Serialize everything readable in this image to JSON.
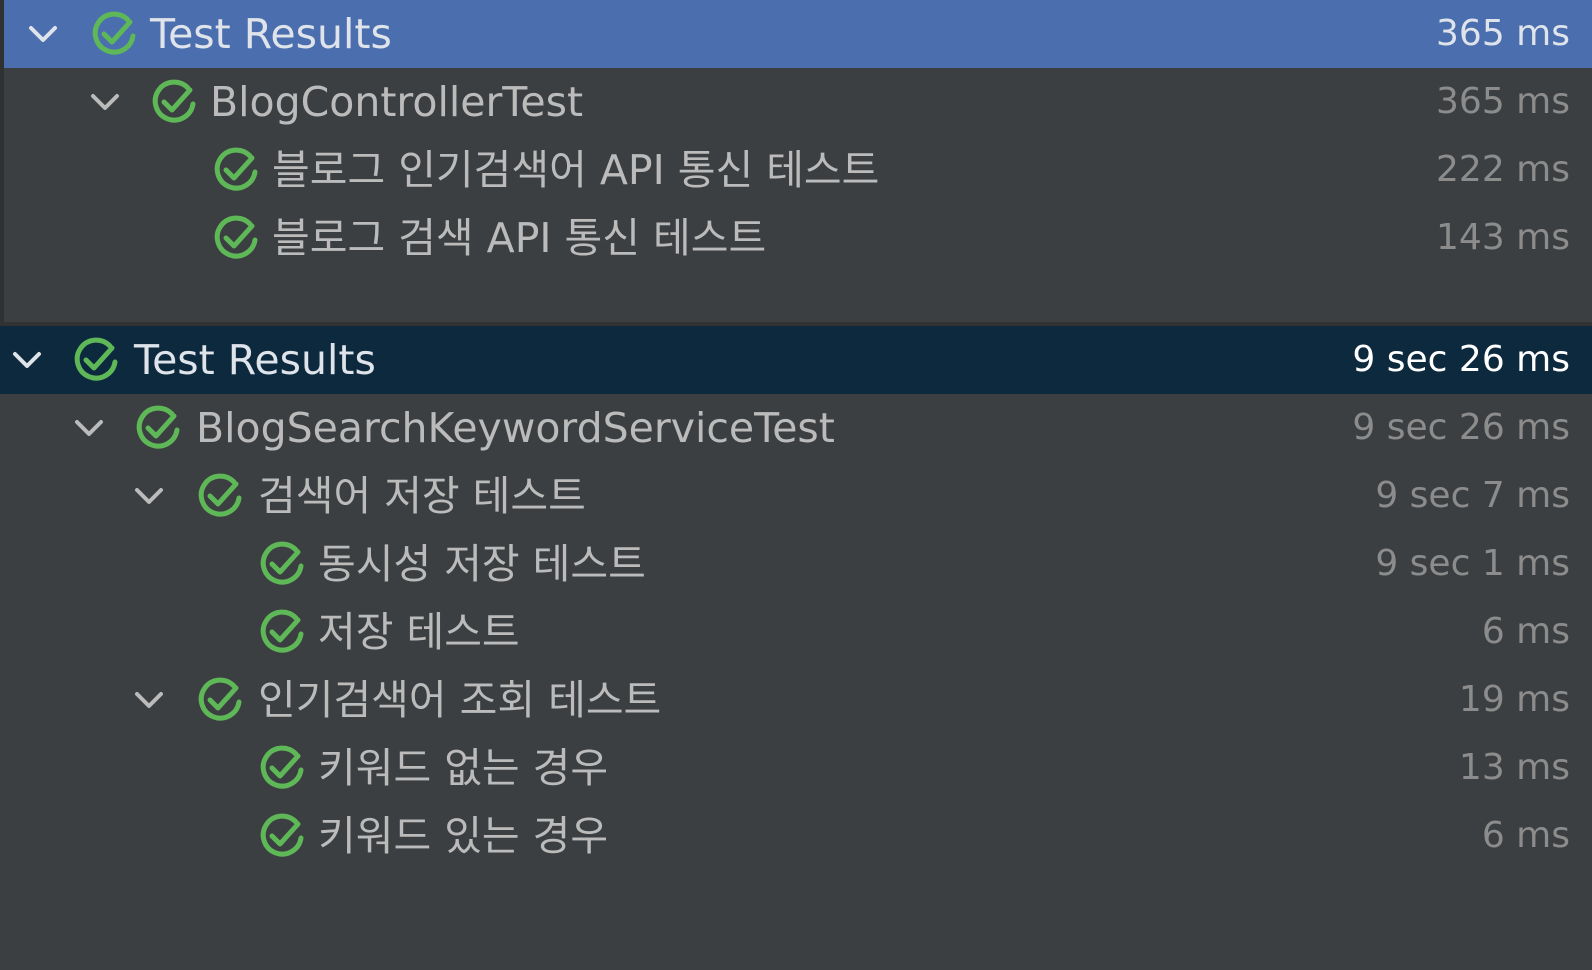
{
  "colors": {
    "background": "#3c3f41",
    "selection_focused": "#4b6eaf",
    "selection_unfocused": "#0d293e",
    "pass_green": "#5fb857",
    "text": "#bbbbbb",
    "duration": "#8c8c8c"
  },
  "panels": [
    {
      "rows": [
        {
          "label": "Test Results",
          "duration": "365 ms",
          "icon": "check-circle-icon",
          "expanded": true
        },
        {
          "label": "BlogControllerTest",
          "duration": "365 ms",
          "icon": "check-circle-icon",
          "expanded": true
        },
        {
          "label": "블로그 인기검색어 API 통신 테스트",
          "duration": "222 ms",
          "icon": "check-circle-icon"
        },
        {
          "label": "블로그 검색 API 통신 테스트",
          "duration": "143 ms",
          "icon": "check-circle-icon"
        }
      ]
    },
    {
      "rows": [
        {
          "label": "Test Results",
          "duration": "9 sec 26 ms",
          "icon": "check-circle-icon",
          "expanded": true
        },
        {
          "label": "BlogSearchKeywordServiceTest",
          "duration": "9 sec 26 ms",
          "icon": "check-circle-icon",
          "expanded": true
        },
        {
          "label": "검색어 저장 테스트",
          "duration": "9 sec 7 ms",
          "icon": "check-circle-icon",
          "expanded": true
        },
        {
          "label": "동시성 저장 테스트",
          "duration": "9 sec 1 ms",
          "icon": "check-circle-icon"
        },
        {
          "label": "저장 테스트",
          "duration": "6 ms",
          "icon": "check-circle-icon"
        },
        {
          "label": "인기검색어 조회 테스트",
          "duration": "19 ms",
          "icon": "check-circle-icon",
          "expanded": true
        },
        {
          "label": "키워드 없는 경우",
          "duration": "13 ms",
          "icon": "check-circle-icon"
        },
        {
          "label": "키워드 있는 경우",
          "duration": "6 ms",
          "icon": "check-circle-icon"
        }
      ]
    }
  ]
}
